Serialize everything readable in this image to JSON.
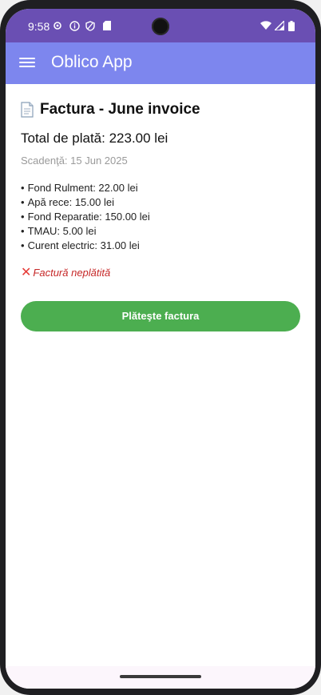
{
  "status_bar": {
    "time": "9:58",
    "icons_left": [
      "settings-icon",
      "info-icon",
      "shield-icon",
      "sd-card-icon"
    ],
    "icons_right": [
      "wifi-icon",
      "signal-icon",
      "battery-icon"
    ]
  },
  "app_bar": {
    "title": "Oblico App",
    "menu_icon": "hamburger-menu-icon",
    "background": "#7d86ee"
  },
  "invoice": {
    "title": "Factura - June invoice",
    "title_icon": "document-icon",
    "total": "Total de plată: 223.00 lei",
    "due": "Scadenţă: 15 Jun 2025",
    "items": [
      "Fond Rulment: 22.00 lei",
      "Apă rece: 15.00 lei",
      "Fond Reparatie: 150.00 lei",
      "TMAU: 5.00 lei",
      "Curent electric: 31.00 lei"
    ],
    "status_text": "Factură neplătită",
    "status_icon": "cross-mark-icon",
    "status_color": "#c62828",
    "pay_button": "Plăteşte factura",
    "pay_button_color": "#4cae50"
  }
}
